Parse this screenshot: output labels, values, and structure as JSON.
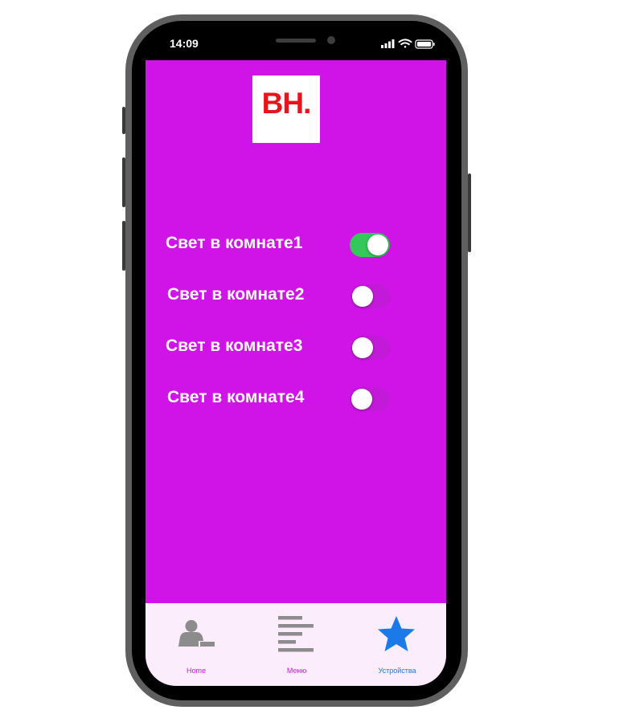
{
  "status_bar": {
    "time": "14:09",
    "icons": [
      "signal-icon",
      "wifi-icon",
      "battery-icon"
    ]
  },
  "logo": {
    "text": "BH."
  },
  "lights": [
    {
      "label": "Свет в комнате1",
      "on": true
    },
    {
      "label": "Свет в комнате2",
      "on": false
    },
    {
      "label": "Свет в комнате3",
      "on": false
    },
    {
      "label": "Свет в комнате4",
      "on": false
    }
  ],
  "tabbar": {
    "tabs": [
      {
        "label": "Home",
        "icon": "user-icon",
        "color": "#d014e8"
      },
      {
        "label": "Меню",
        "icon": "menu-lines-icon",
        "color": "#d014e8"
      },
      {
        "label": "Устройства",
        "icon": "star-icon",
        "color": "#1c79e8"
      }
    ]
  },
  "colors": {
    "screen_background": "#d014e8",
    "logo_text": "#e8141c",
    "toggle_on": "#34c759",
    "tab_active": "#1c79e8",
    "tabbar_background": "#fcedfc"
  }
}
